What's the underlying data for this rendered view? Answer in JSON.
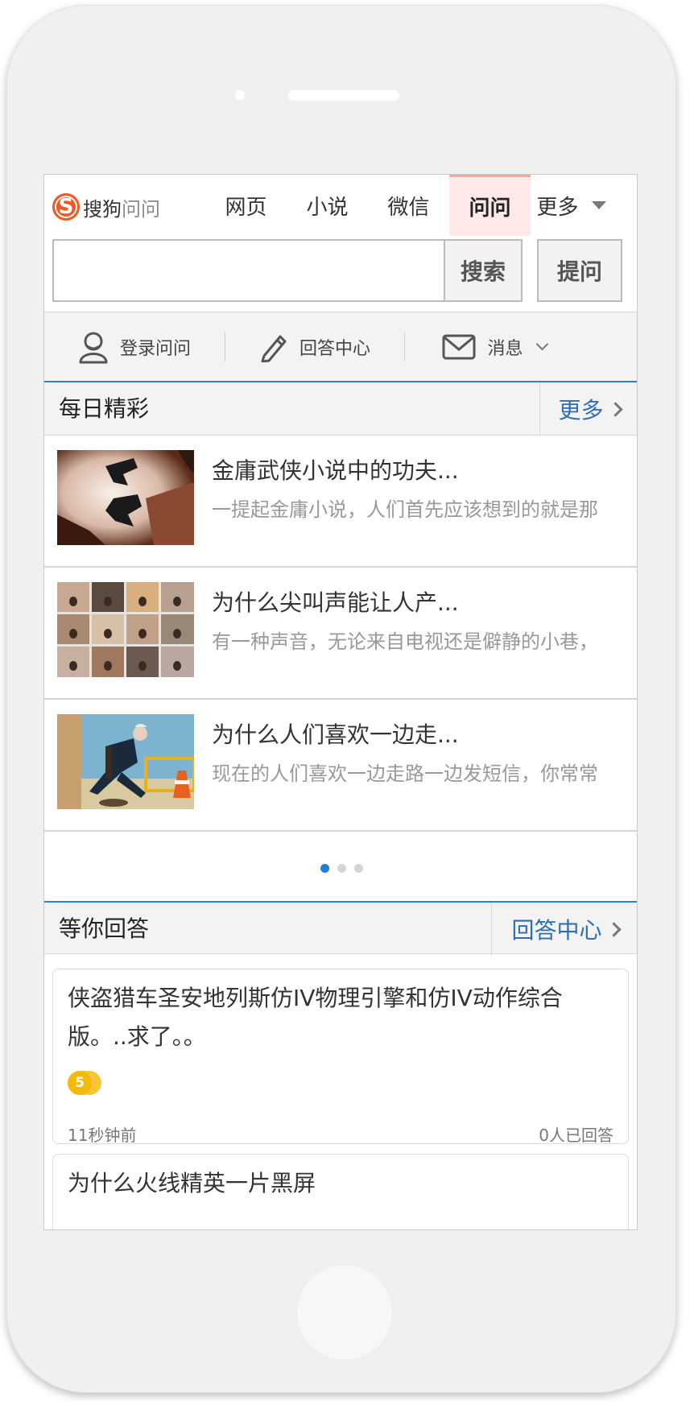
{
  "header": {
    "logo_text_main": "搜狗",
    "logo_text_sub": "问问",
    "logo_glyph": "S",
    "nav": [
      {
        "label": "网页",
        "active": false
      },
      {
        "label": "小说",
        "active": false
      },
      {
        "label": "微信",
        "active": false
      },
      {
        "label": "问问",
        "active": true
      },
      {
        "label": "更多",
        "active": false
      }
    ]
  },
  "search": {
    "placeholder": "",
    "value": "",
    "search_label": "搜索",
    "ask_label": "提问"
  },
  "userbar": {
    "login": "登录问问",
    "answer_center": "回答中心",
    "messages": "消息"
  },
  "daily": {
    "title": "每日精彩",
    "more": "更多",
    "articles": [
      {
        "title": "金庸武侠小说中的功夫...",
        "desc": "一提起金庸小说，人们首先应该想到的就是那",
        "thumb": "martial-arts-silhouette"
      },
      {
        "title": "为什么尖叫声能让人产...",
        "desc": "有一种声音，无论来自电视还是僻静的小巷，",
        "thumb": "screaming-faces-grid"
      },
      {
        "title": "为什么人们喜欢一边走...",
        "desc": "现在的人们喜欢一边走路一边发短信，你常常",
        "thumb": "man-walking-texting"
      }
    ],
    "pager": {
      "count": 3,
      "active": 1
    }
  },
  "waiting": {
    "title": "等你回答",
    "more": "回答中心",
    "questions": [
      {
        "title": "侠盗猎车圣安地列斯仿IV物理引擎和仿IV动作综合版。..求了。。",
        "reward": "5",
        "time": "11秒钟前",
        "answers": "0人已回答"
      },
      {
        "title": "为什么火线精英一片黑屏"
      }
    ]
  },
  "colors": {
    "accent_blue": "#2b83cf",
    "brand_orange": "#f05a22",
    "coin_gold": "#f5b90b",
    "active_tab_bg": "#fdeae8"
  }
}
